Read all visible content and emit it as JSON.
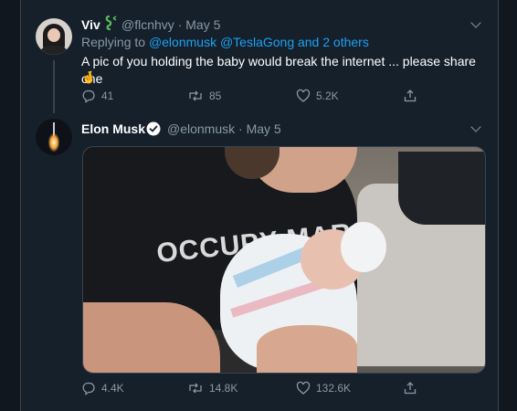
{
  "reply": {
    "display_name": "Viv",
    "handle": "@flcnhvy",
    "separator": "·",
    "date": "May 5",
    "replying_prefix": "Replying to",
    "replying_to": "@elonmusk @TeslaGong and 2 others",
    "text": "A pic of you holding the baby would break the internet ... please share one",
    "emoji": "🤞",
    "badge_icon": "snake-emoji",
    "actions": {
      "replies": "41",
      "retweets": "85",
      "likes": "5.2K"
    }
  },
  "tweet": {
    "display_name": "Elon Musk",
    "handle": "@elonmusk",
    "separator": "·",
    "date": "May 5",
    "verified_icon": "verified-badge",
    "shirt_text": "OCCUPY MARS",
    "actions": {
      "replies": "4.4K",
      "retweets": "14.8K",
      "likes": "132.6K"
    }
  },
  "colors": {
    "background": "#15202b",
    "muted": "#8899a6",
    "link": "#1da1f2",
    "divider": "#38444d"
  }
}
